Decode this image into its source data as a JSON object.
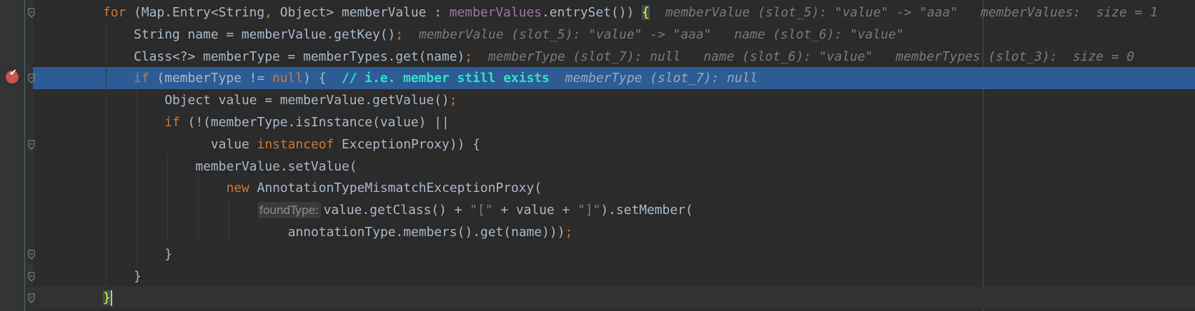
{
  "editor": {
    "lines": [
      {
        "indent": 0,
        "tokens": [
          {
            "text": "for",
            "c": "kw"
          },
          {
            "text": " (Map.Entry<String",
            "c": "pl"
          },
          {
            "text": ",",
            "c": "kw"
          },
          {
            "text": " Object> memberValue : ",
            "c": "pl"
          },
          {
            "text": "memberValues",
            "c": "fd"
          },
          {
            "text": ".entrySet()) ",
            "c": "pl"
          },
          {
            "text": "{",
            "c": "br"
          }
        ],
        "hints": [
          "memberValue (slot_5): \"value\" -> \"aaa\"",
          "memberValues:  size = 1"
        ]
      },
      {
        "indent": 4,
        "tokens": [
          {
            "text": "String name = memberValue.getKey()",
            "c": "pl"
          },
          {
            "text": ";",
            "c": "semi"
          }
        ],
        "hints": [
          "memberValue (slot_5): \"value\" -> \"aaa\"",
          "name (slot_6): \"value\""
        ]
      },
      {
        "indent": 4,
        "tokens": [
          {
            "text": "Class<?> memberType = memberTypes.get(name)",
            "c": "pl"
          },
          {
            "text": ";",
            "c": "semi"
          }
        ],
        "hints": [
          "memberType (slot_7): null",
          "name (slot_6): \"value\"",
          "memberTypes (slot_3):  size = 0"
        ]
      },
      {
        "indent": 4,
        "exec": true,
        "tokens": [
          {
            "text": "if",
            "c": "kw"
          },
          {
            "text": " (memberType != ",
            "c": "pl"
          },
          {
            "text": "null",
            "c": "kw"
          },
          {
            "text": ") {  ",
            "c": "pl"
          },
          {
            "text": "// i.e. member still exists",
            "c": "cm"
          }
        ],
        "hints": [
          "memberType (slot_7): null"
        ]
      },
      {
        "indent": 8,
        "tokens": [
          {
            "text": "Object value = memberValue.getValue()",
            "c": "pl"
          },
          {
            "text": ";",
            "c": "semi"
          }
        ]
      },
      {
        "indent": 8,
        "tokens": [
          {
            "text": "if",
            "c": "kw"
          },
          {
            "text": " (!(memberType.isInstance(value) ||",
            "c": "pl"
          }
        ]
      },
      {
        "indent": 14,
        "tokens": [
          {
            "text": "value ",
            "c": "pl"
          },
          {
            "text": "instanceof",
            "c": "kw"
          },
          {
            "text": " ExceptionProxy)) {",
            "c": "pl"
          }
        ]
      },
      {
        "indent": 12,
        "tokens": [
          {
            "text": "memberValue.setValue(",
            "c": "pl"
          }
        ]
      },
      {
        "indent": 16,
        "tokens": [
          {
            "text": "new",
            "c": "kw"
          },
          {
            "text": " AnnotationTypeMismatchExceptionProxy(",
            "c": "pl"
          }
        ]
      },
      {
        "indent": 20,
        "inlay": "foundType:",
        "tokens": [
          {
            "text": "value.getClass() + ",
            "c": "pl"
          },
          {
            "text": "\"[\"",
            "c": "st"
          },
          {
            "text": " + value + ",
            "c": "pl"
          },
          {
            "text": "\"]\"",
            "c": "st"
          },
          {
            "text": ").setMember(",
            "c": "pl"
          }
        ]
      },
      {
        "indent": 24,
        "tokens": [
          {
            "text": "annotationType.members().get(name)))",
            "c": "pl"
          },
          {
            "text": ";",
            "c": "semi"
          }
        ]
      },
      {
        "indent": 8,
        "tokens": [
          {
            "text": "}",
            "c": "pl"
          }
        ]
      },
      {
        "indent": 4,
        "tokens": [
          {
            "text": "}",
            "c": "pl"
          }
        ]
      },
      {
        "indent": 0,
        "caret": true,
        "tokens": [
          {
            "text": "}",
            "c": "br"
          }
        ]
      }
    ]
  },
  "gutter": {
    "breakpoint_line": 3,
    "fold_lines": [
      0,
      3,
      6,
      11,
      12,
      13
    ]
  }
}
